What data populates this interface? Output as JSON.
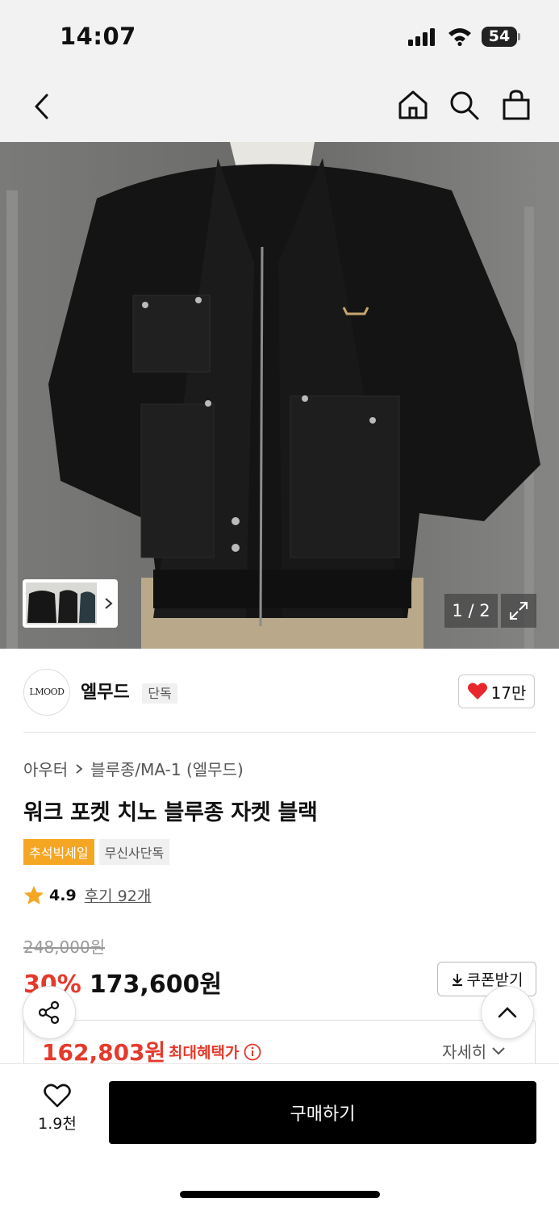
{
  "status_bar": {
    "time": "14:07",
    "battery": "54"
  },
  "nav": {
    "back_icon": "chevron-left-icon",
    "home_icon": "home-icon",
    "search_icon": "search-icon",
    "cart_icon": "shopping-bag-icon"
  },
  "gallery": {
    "counter": "1 / 2",
    "expand_icon": "expand-icon"
  },
  "brand": {
    "logo_text": "LMOOD",
    "name": "엘무드",
    "badge": "단독",
    "likes": "17만"
  },
  "breadcrumb": {
    "category": "아우터",
    "subcategory": "블루종/MA-1 (엘무드)"
  },
  "product": {
    "title": "워크 포켓 치노 블루종 자켓 블랙",
    "tags": [
      "추석빅세일",
      "무신사단독"
    ],
    "rating": "4.9",
    "reviews": "후기 92개",
    "original_price": "248,000원",
    "discount": "30%",
    "sale_price": "173,600원",
    "coupon_label": "쿠폰받기",
    "best_price": "162,803원",
    "best_price_label": "최대혜택가",
    "detail_label": "자세히"
  },
  "bottom_bar": {
    "wish_count": "1.9천",
    "buy_label": "구매하기"
  },
  "colors": {
    "accent_red": "#e53a2b",
    "tag_orange": "#f5a623",
    "buy_button": "#000000"
  }
}
